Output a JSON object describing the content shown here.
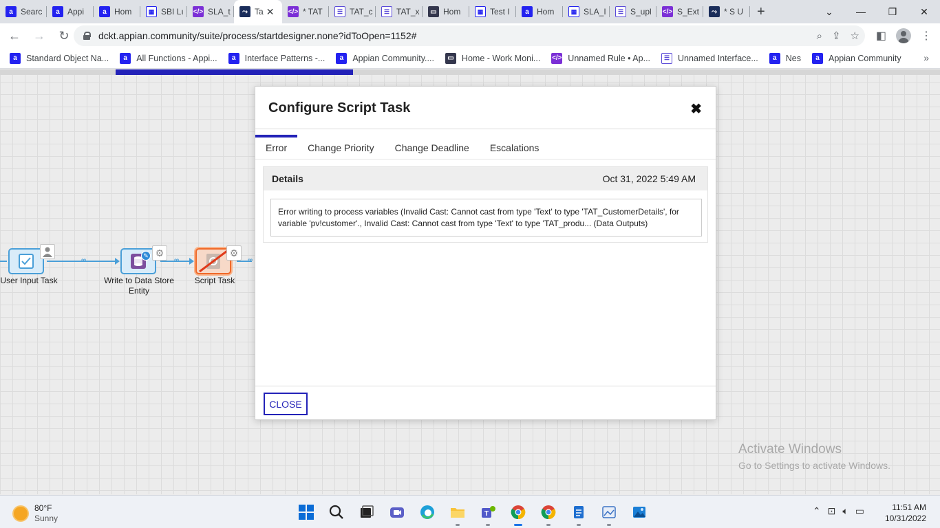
{
  "browser": {
    "tabs": [
      {
        "label": "Searc",
        "favicon": "appian-a-icon",
        "active": false
      },
      {
        "label": "Appi",
        "favicon": "appian-a-icon",
        "active": false
      },
      {
        "label": "Hom",
        "favicon": "appian-a-icon",
        "active": false
      },
      {
        "label": "SBI Lı",
        "favicon": "grid-icon",
        "active": false
      },
      {
        "label": "SLA_t",
        "favicon": "code-icon",
        "active": false
      },
      {
        "label": "Ta",
        "favicon": "process-icon",
        "active": true
      },
      {
        "label": "* TAT",
        "favicon": "code-icon",
        "active": false
      },
      {
        "label": "TAT_c",
        "favicon": "form-icon",
        "active": false
      },
      {
        "label": "TAT_x",
        "favicon": "form-icon",
        "active": false
      },
      {
        "label": "Hom",
        "favicon": "monitor-icon",
        "active": false
      },
      {
        "label": "Test I",
        "favicon": "grid-icon",
        "active": false
      },
      {
        "label": "Hom",
        "favicon": "appian-a-icon",
        "active": false
      },
      {
        "label": "SLA_I",
        "favicon": "grid-icon",
        "active": false
      },
      {
        "label": "S_upl",
        "favicon": "form-icon",
        "active": false
      },
      {
        "label": "S_Ext",
        "favicon": "code-icon",
        "active": false
      },
      {
        "label": "* S U",
        "favicon": "process-icon",
        "active": false
      }
    ],
    "url": "dckt.appian.community/suite/process/startdesigner.none?idToOpen=1152#",
    "bookmarks": [
      {
        "label": "Standard Object Na...",
        "favicon": "appian-a-icon"
      },
      {
        "label": "All Functions - Appi...",
        "favicon": "appian-a-icon"
      },
      {
        "label": "Interface Patterns -...",
        "favicon": "appian-a-icon"
      },
      {
        "label": "Appian Community....",
        "favicon": "appian-a-icon"
      },
      {
        "label": "Home - Work Moni...",
        "favicon": "monitor-icon"
      },
      {
        "label": "Unnamed Rule • Ap...",
        "favicon": "code-icon"
      },
      {
        "label": "Unnamed Interface...",
        "favicon": "form-icon"
      },
      {
        "label": "Nes",
        "favicon": "appian-a-icon"
      },
      {
        "label": "Appian Community",
        "favicon": "appian-a-icon"
      }
    ]
  },
  "designer": {
    "nodes": [
      {
        "label": "User Input Task"
      },
      {
        "label": "Write to Data Store Entity"
      },
      {
        "label": "Script Task"
      }
    ]
  },
  "modal": {
    "title": "Configure Script Task",
    "tabs": [
      "Error",
      "Change Priority",
      "Change Deadline",
      "Escalations"
    ],
    "active_tab": "Error",
    "details_label": "Details",
    "timestamp": "Oct 31, 2022 5:49 AM",
    "error_message": "Error writing to process variables (Invalid Cast: Cannot cast from type 'Text' to type 'TAT_CustomerDetails', for variable 'pv!customer'., Invalid Cast: Cannot cast from type 'Text' to type 'TAT_produ... (Data Outputs)",
    "close_label": "CLOSE"
  },
  "watermark": {
    "line1": "Activate Windows",
    "line2": "Go to Settings to activate Windows."
  },
  "taskbar": {
    "temperature": "80°F",
    "condition": "Sunny",
    "time": "11:51 AM",
    "date": "10/31/2022"
  },
  "colors": {
    "appian_blue": "#2322b8",
    "node_blue": "#4a9fd8",
    "error_orange": "#f06a2a"
  }
}
